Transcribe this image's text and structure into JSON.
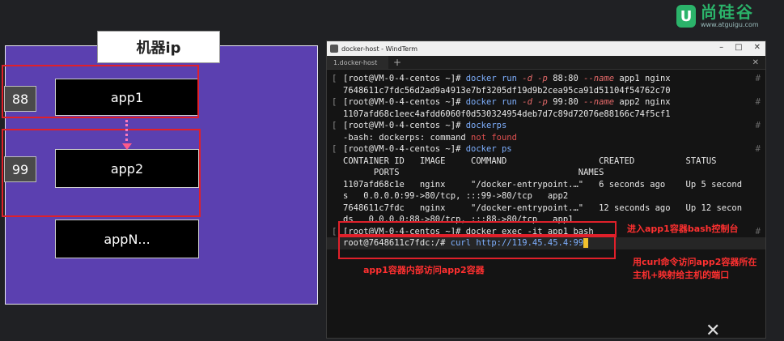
{
  "diagram": {
    "host_title": "机器ip",
    "apps": [
      "app1",
      "app2",
      "appN..."
    ],
    "ports": [
      "88",
      "99"
    ]
  },
  "logo": {
    "mark": "U",
    "name": "尚硅谷",
    "url": "www.atguigu.com"
  },
  "window": {
    "title": "docker-host - WindTerm",
    "tab": "1.docker-host",
    "controls": [
      "–",
      "□",
      "✕"
    ]
  },
  "terminal": {
    "lines": [
      {
        "g": "[",
        "t": [
          [
            "[root@VM-0-4-centos ~]# ",
            ""
          ],
          [
            "docker run ",
            "k"
          ],
          [
            "-d -p ",
            "f"
          ],
          [
            "88:80 ",
            ""
          ],
          [
            "--name ",
            "f"
          ],
          [
            "app1 nginx",
            ""
          ]
        ]
      },
      {
        "g": "",
        "t": [
          [
            "7648611c7fdc56d2ad9a4913e7bf3205df19d9b2cea95ca91d51104f54762c70",
            ""
          ]
        ]
      },
      {
        "g": "[",
        "t": [
          [
            "[root@VM-0-4-centos ~]# ",
            ""
          ],
          [
            "docker run ",
            "k"
          ],
          [
            "-d -p ",
            "f"
          ],
          [
            "99:80 ",
            ""
          ],
          [
            "--name ",
            "f"
          ],
          [
            "app2 nginx",
            ""
          ]
        ]
      },
      {
        "g": "",
        "t": [
          [
            "1107afd68c1eec4afdd6060f0d530324954deb7d7c89d72076e88166c74f5cf1",
            ""
          ]
        ]
      },
      {
        "g": "[",
        "t": [
          [
            "[root@VM-0-4-centos ~]# ",
            ""
          ],
          [
            "dockerps",
            "k"
          ]
        ]
      },
      {
        "g": "",
        "t": [
          [
            "-bash: dockerps: command ",
            ""
          ],
          [
            "not found",
            "nf"
          ]
        ]
      },
      {
        "g": "[",
        "t": [
          [
            "[root@VM-0-4-centos ~]# ",
            ""
          ],
          [
            "docker ps",
            "k"
          ]
        ]
      },
      {
        "g": "",
        "t": [
          [
            "CONTAINER ID   IMAGE     COMMAND                  CREATED          STATUS",
            ""
          ]
        ]
      },
      {
        "g": "",
        "t": [
          [
            "      PORTS                                   NAMES",
            ""
          ]
        ]
      },
      {
        "g": "",
        "t": [
          [
            "1107afd68c1e   nginx     \"/docker-entrypoint.…\"   6 seconds ago    Up 5 second",
            ""
          ]
        ]
      },
      {
        "g": "",
        "t": [
          [
            "s   0.0.0.0:99->80/tcp, :::99->80/tcp   app2",
            ""
          ]
        ]
      },
      {
        "g": "",
        "t": [
          [
            "7648611c7fdc   nginx     \"/docker-entrypoint.…\"   12 seconds ago   Up 12 secon",
            ""
          ]
        ]
      },
      {
        "g": "",
        "t": [
          [
            "ds   0.0.0.0:88->80/tcp, :::88->80/tcp   app1",
            ""
          ]
        ]
      },
      {
        "g": "[",
        "t": [
          [
            "[root@VM-0-4-centos ~]# ",
            ""
          ],
          [
            "docker exec -it app1 bash",
            ""
          ]
        ]
      },
      {
        "g": "",
        "t": [
          [
            "root@7648611c7fdc:/# ",
            ""
          ],
          [
            "curl http://119.45.45.4:99",
            "k"
          ]
        ],
        "cursor": true
      }
    ]
  },
  "annotations": {
    "bash_console": "进入app1容器bash控制台",
    "app1_to_app2": "app1容器内部访问app2容器",
    "curl_line1": "用curl命令访问app2容器所在",
    "curl_line2": "主机+映射给主机的端口"
  },
  "colors": {
    "host_bg": "#5b40b0",
    "outline": "#e0202a",
    "annotation": "#ff3030",
    "cursor": "#f2c12e",
    "logo": "#2bb36a"
  }
}
